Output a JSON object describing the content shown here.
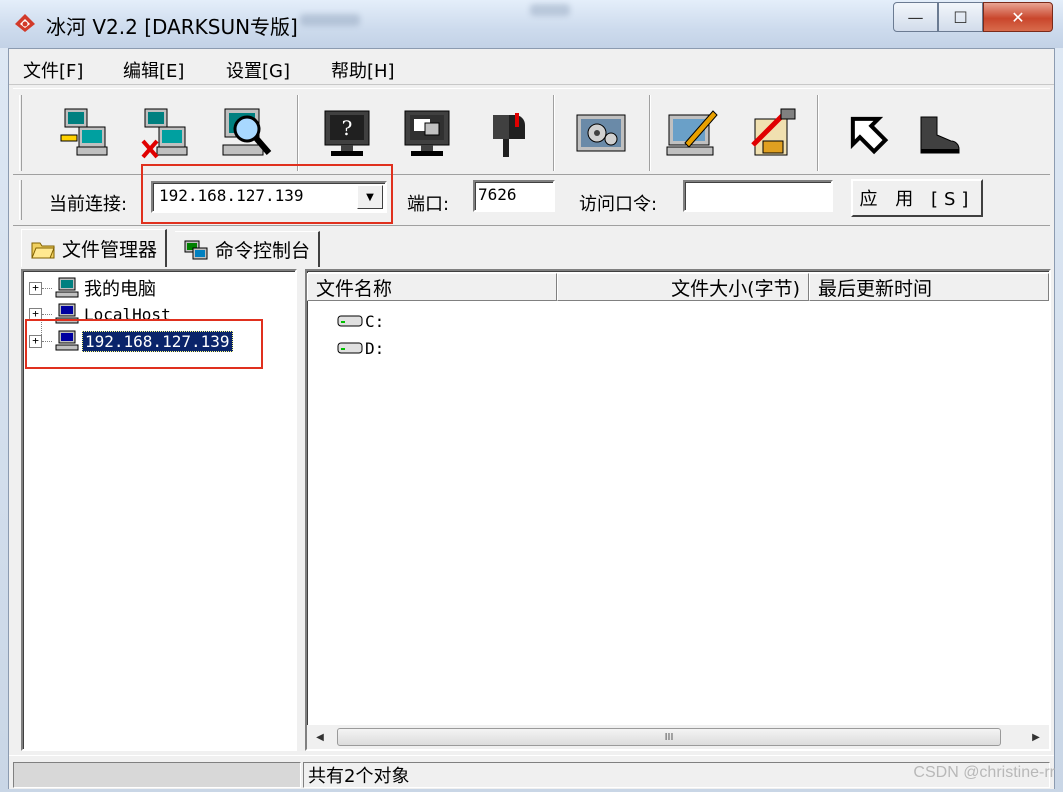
{
  "window": {
    "title": "冰河 V2.2 [DARKSUN专版]",
    "caption_minimize": "—",
    "caption_maximize": "☐",
    "caption_close": "✕"
  },
  "menu": {
    "file": "文件[F]",
    "edit": "编辑[E]",
    "settings": "设置[G]",
    "help": "帮助[H]"
  },
  "toolbar": {
    "icons": [
      "add-computer-icon",
      "delete-computer-icon",
      "search-computer-icon",
      "help-monitor-icon",
      "screen-capture-icon",
      "mailbox-icon",
      "system-settings-icon",
      "notepad-icon",
      "tools-icon",
      "up-arrow-icon",
      "exit-boot-icon"
    ]
  },
  "connection": {
    "current_label": "当前连接:",
    "current_value": "192.168.127.139",
    "port_label": "端口:",
    "port_value": "7626",
    "password_label": "访问口令:",
    "password_value": "",
    "apply_label": "应 用 [S]"
  },
  "tabs": {
    "file_manager": "文件管理器",
    "command_console": "命令控制台"
  },
  "tree": {
    "items": [
      {
        "label": "我的电脑",
        "expander": "+"
      },
      {
        "label": "LocalHost",
        "expander": "+"
      },
      {
        "label": "192.168.127.139",
        "expander": "+",
        "selected": true
      }
    ]
  },
  "filelist": {
    "columns": [
      "文件名称",
      "文件大小(字节)",
      "最后更新时间"
    ],
    "rows": [
      {
        "name": "C:"
      },
      {
        "name": "D:"
      }
    ],
    "scroll_left": "◀",
    "scroll_right": "▶",
    "scroll_grip": "III"
  },
  "status": {
    "left": "",
    "right": "共有2个对象"
  },
  "watermark": "CSDN @christine-rr",
  "colors": {
    "selection": "#0a246a",
    "highlight_box": "#e0301e",
    "close_button": "#c9462c"
  }
}
